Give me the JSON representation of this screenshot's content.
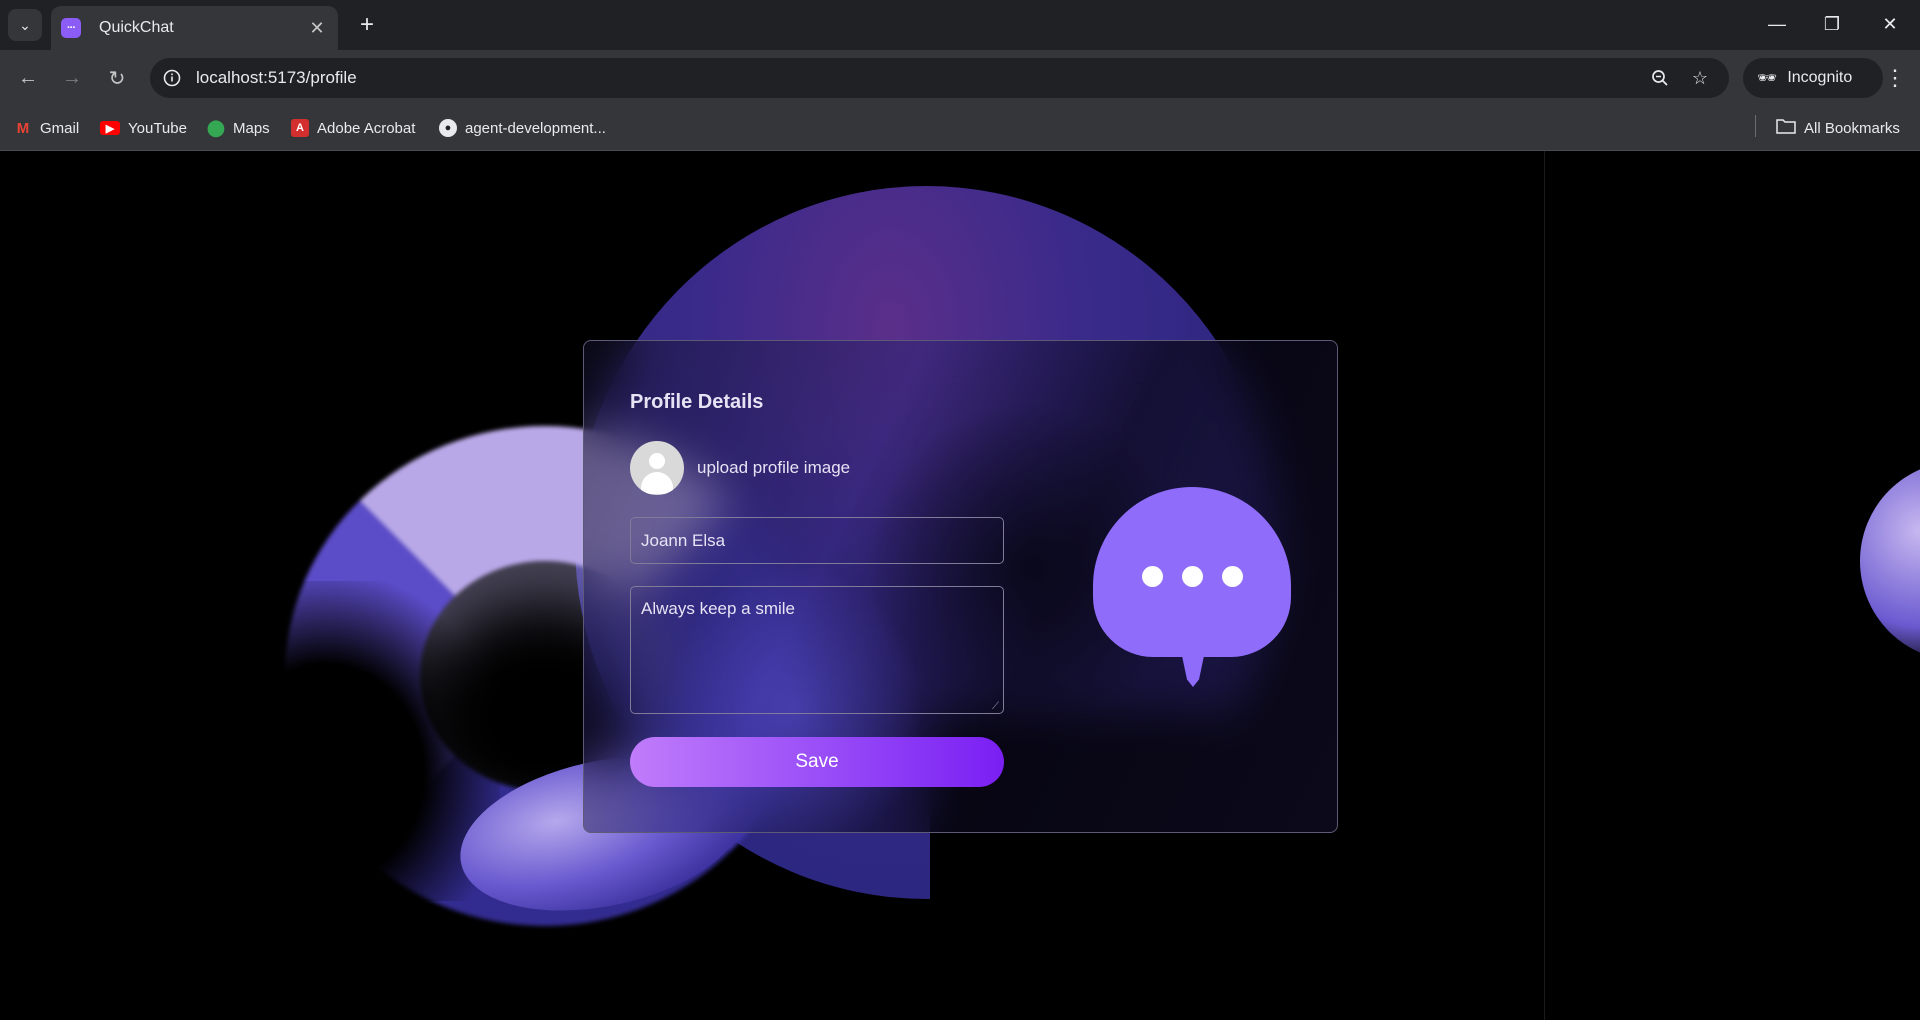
{
  "browser": {
    "tab": {
      "title": "QuickChat",
      "favicon": "chat-bubble-icon"
    },
    "url": "localhost:5173/profile",
    "incognito_label": "Incognito",
    "bookmarks": [
      {
        "label": "Gmail",
        "icon": "gmail-icon",
        "color": "#ea4335"
      },
      {
        "label": "YouTube",
        "icon": "youtube-icon",
        "color": "#ff0000"
      },
      {
        "label": "Maps",
        "icon": "maps-icon",
        "color": "#34a853"
      },
      {
        "label": "Adobe Acrobat",
        "icon": "acrobat-icon",
        "color": "#d32f2f"
      },
      {
        "label": "agent-development...",
        "icon": "github-icon",
        "color": "#ffffff"
      }
    ],
    "all_bookmarks_label": "All Bookmarks"
  },
  "profile": {
    "title": "Profile Details",
    "upload_label": "upload profile image",
    "name_value": "Joann Elsa",
    "bio_value": "Always keep a smile",
    "save_label": "Save"
  },
  "colors": {
    "accent": "#8f6cfa",
    "button_start": "#c07cfb",
    "button_end": "#7a1ff3"
  }
}
